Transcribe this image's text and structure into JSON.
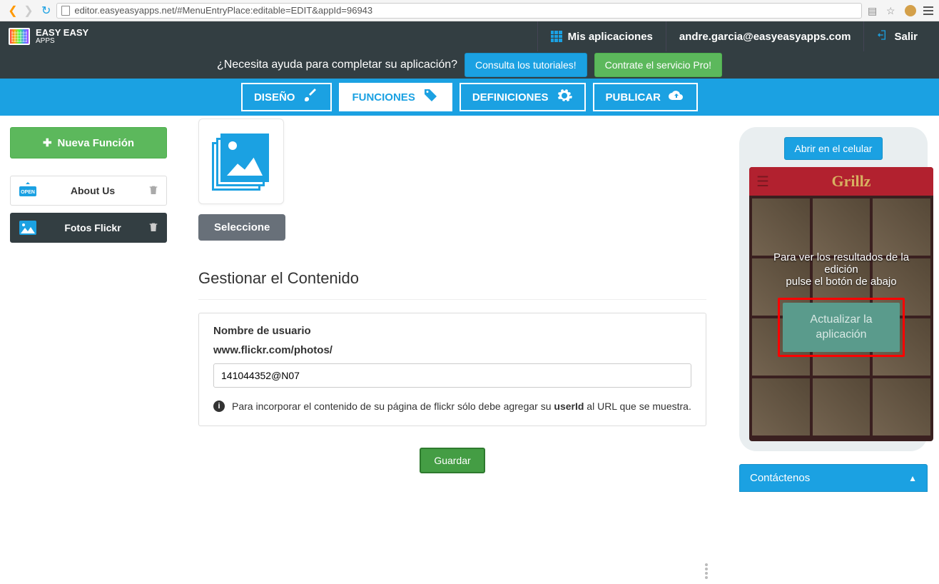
{
  "browser": {
    "url": "editor.easyeasyapps.net/#MenuEntryPlace:editable=EDIT&appId=96943"
  },
  "header": {
    "logo_line1": "EASY EASY",
    "logo_line2": "APPS",
    "my_apps": "Mis aplicaciones",
    "user_email": "andre.garcia@easyeasyapps.com",
    "logout": "Salir"
  },
  "helpbar": {
    "question": "¿Necesita ayuda para completar su aplicación?",
    "tutorials": "Consulta los tutoriales!",
    "pro": "Contrate el servicio Pro!"
  },
  "tabs": {
    "design": "DISEÑO",
    "functions": "FUNCIONES",
    "definitions": "DEFINICIONES",
    "publish": "PUBLICAR"
  },
  "sidebar": {
    "new_function": "Nueva Función",
    "items": [
      {
        "label": "About Us"
      },
      {
        "label": "Fotos Flickr"
      }
    ]
  },
  "content": {
    "select": "Seleccione",
    "section_title": "Gestionar el Contenido",
    "username_label": "Nombre de usuario",
    "flickr_url": "www.flickr.com/photos/",
    "username_value": "141044352@N07",
    "info_pre": "Para incorporar el contenido de su página de flickr sólo debe agregar su ",
    "info_bold": "userId",
    "info_post": " al URL que se muestra.",
    "save": "Guardar"
  },
  "preview": {
    "open_mobile": "Abrir en el celular",
    "app_title": "Grillz",
    "overlay_line1": "Para ver los resultados de la edición",
    "overlay_line2": "pulse el botón de abajo",
    "update_line1": "Actualizar la",
    "update_line2": "aplicación",
    "contact": "Contáctenos"
  }
}
